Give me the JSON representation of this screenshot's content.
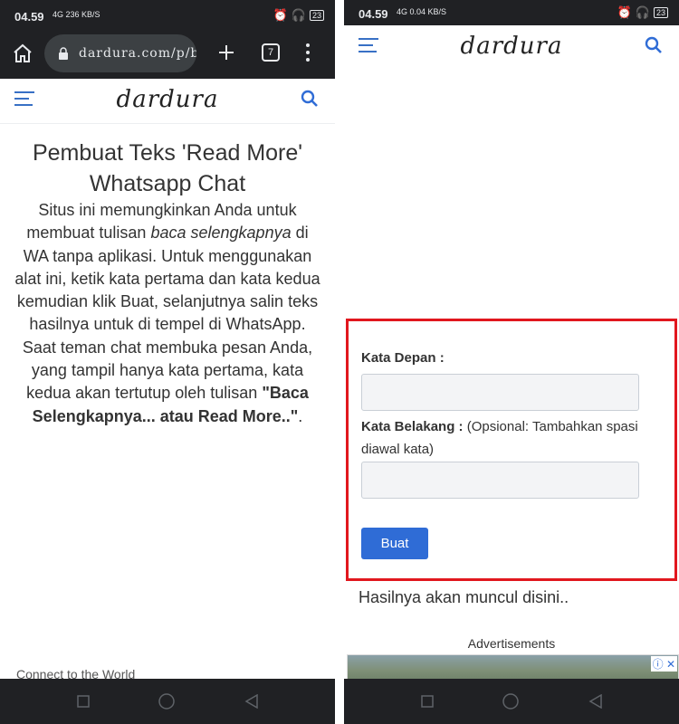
{
  "status_left": {
    "time": "04.59",
    "net": "4G",
    "speed": "236 KB/S",
    "battery": "23"
  },
  "status_right": {
    "time": "04.59",
    "net": "4G",
    "speed": "0.04 KB/S",
    "battery": "23"
  },
  "browser": {
    "url": "dardura.com/p/bu",
    "tab_count": "7"
  },
  "site": {
    "logo": "dardura"
  },
  "article": {
    "title": "Pembuat Teks 'Read More' Whatsapp Chat",
    "p1": "Situs ini memungkinkan Anda untuk membuat tulisan",
    "p1_italic": "baca selengkapnya",
    "p2": "di WA tanpa aplikasi. Untuk menggunakan alat ini, ketik kata pertama dan kata kedua kemudian klik Buat, selanjutnya salin teks hasilnya untuk di tempel di WhatsApp. Saat teman chat membuka pesan Anda, yang tampil hanya kata pertama, kata kedua akan tertutup oleh tulisan",
    "p2_bold": "\"Baca Selengkapnya... atau Read More..\"",
    "p2_end": ".",
    "faded_text": "Connect to the World"
  },
  "form": {
    "label_front": "Kata Depan :",
    "label_back": "Kata Belakang :",
    "label_back_note": "(Opsional: Tambahkan spasi diawal kata)",
    "button": "Buat",
    "result": "Hasilnya akan muncul disini..",
    "ads_label": "Advertisements",
    "ad_close": "ⓘ ✕"
  },
  "colors": {
    "accent": "#2f6cd6",
    "highlight": "#e1171e",
    "chrome": "#202124"
  },
  "icons": [
    "home-icon",
    "lock-icon",
    "add-tab-icon",
    "menu-dots-icon",
    "hamburger-icon",
    "search-icon",
    "nav-square-icon",
    "nav-circle-icon",
    "nav-back-icon"
  ]
}
